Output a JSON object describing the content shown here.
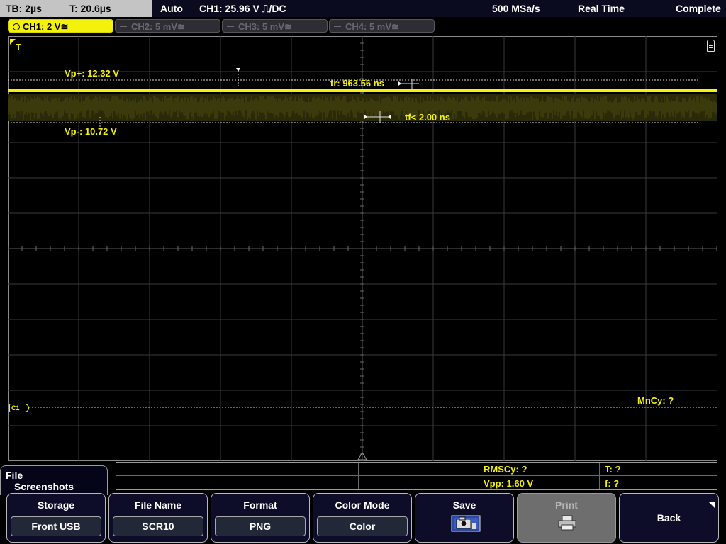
{
  "status_bar": {
    "timebase": "TB: 2µs",
    "trigger_time": "T: 20.6µs",
    "trigger_mode": "Auto",
    "trigger_info": "CH1: 25.96 V ⎍/DC",
    "sample_rate": "500 MSa/s",
    "acq_mode": "Real Time",
    "acq_status": "Complete"
  },
  "channels": [
    {
      "label": "CH1: 2 V≅",
      "active": true
    },
    {
      "label": "CH2: 5 mV≅",
      "active": false
    },
    {
      "label": "CH3: 5 mV≅",
      "active": false
    },
    {
      "label": "CH4: 5 mV≅",
      "active": false
    }
  ],
  "measurements": {
    "vp_plus": "Vp+: 12.32 V",
    "vp_minus": "Vp-: 10.72 V",
    "tr": "tr: 963.56 ns",
    "tf": "tf< 2.00 ns",
    "mncy": "MnCy: ?",
    "trigger_marker": "T",
    "ch1_marker": "C1"
  },
  "info_table": {
    "rmscy": "RMSCy: ?",
    "t": "T: ?",
    "vpp": "Vpp: 1.60 V",
    "f": "f: ?"
  },
  "menu": {
    "title_line1": "File",
    "title_line2": "Screenshots"
  },
  "softkeys": {
    "storage_label": "Storage",
    "storage_value": "Front USB",
    "filename_label": "File Name",
    "filename_value": "SCR10",
    "format_label": "Format",
    "format_value": "PNG",
    "colormode_label": "Color Mode",
    "colormode_value": "Color",
    "save_label": "Save",
    "print_label": "Print",
    "back_label": "Back"
  },
  "colors": {
    "ch1": "#f4f20c",
    "background": "#000000",
    "softkey_bg": "#0d0d2a"
  },
  "icons": [
    "camera-save-icon",
    "printer-icon",
    "menu-lock-icon",
    "trigger-arrow-icon"
  ]
}
